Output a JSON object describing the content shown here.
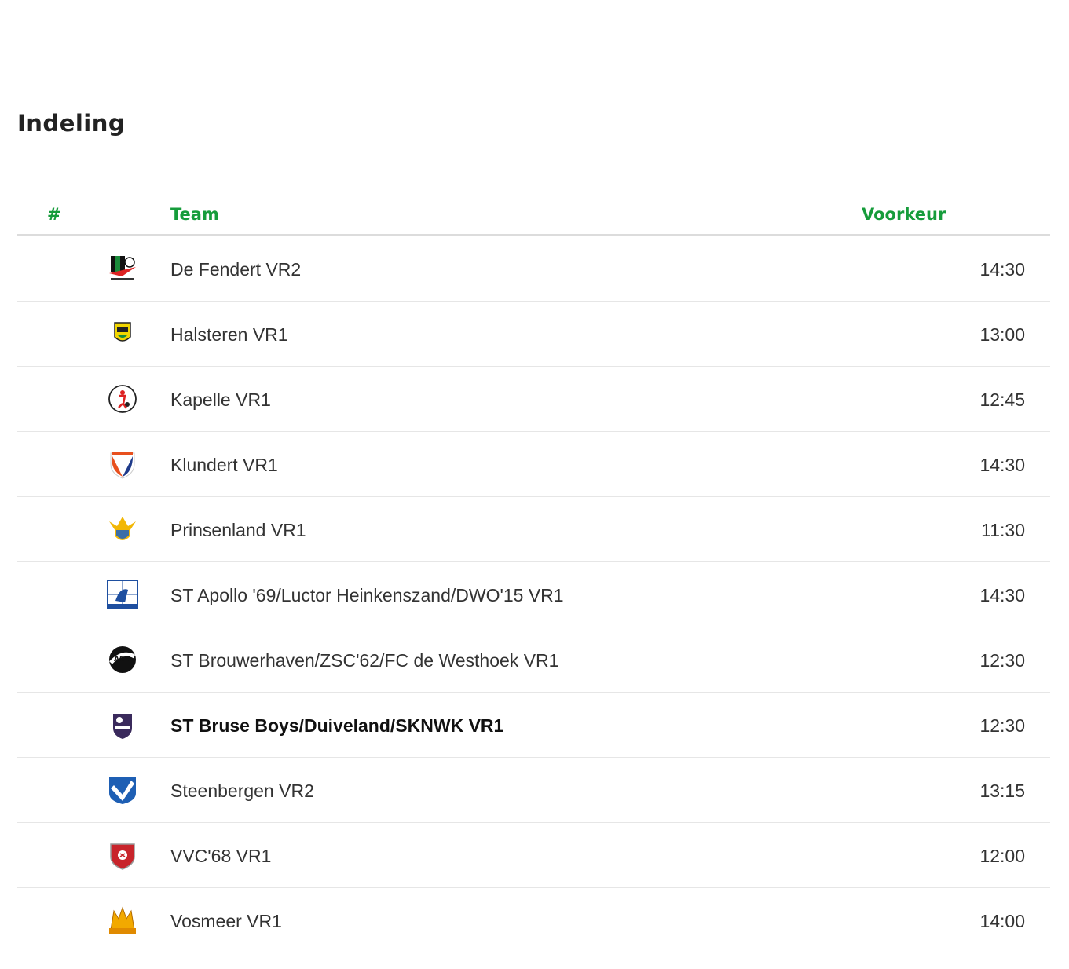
{
  "page": {
    "title": "Indeling"
  },
  "table": {
    "headers": {
      "num": "#",
      "team": "Team",
      "preference": "Voorkeur"
    },
    "rows": [
      {
        "team": "De Fendert VR2",
        "time": "14:30",
        "logo": "de-fendert-logo",
        "highlight": false
      },
      {
        "team": "Halsteren VR1",
        "time": "13:00",
        "logo": "halsteren-logo",
        "highlight": false
      },
      {
        "team": "Kapelle VR1",
        "time": "12:45",
        "logo": "kapelle-logo",
        "highlight": false
      },
      {
        "team": "Klundert VR1",
        "time": "14:30",
        "logo": "klundert-logo",
        "highlight": false
      },
      {
        "team": "Prinsenland VR1",
        "time": "11:30",
        "logo": "prinsenland-logo",
        "highlight": false
      },
      {
        "team": "ST Apollo '69/Luctor Heinkenszand/DWO'15 VR1",
        "time": "14:30",
        "logo": "apollo-logo",
        "highlight": false
      },
      {
        "team": "ST Brouwerhaven/ZSC'62/FC de Westhoek VR1",
        "time": "12:30",
        "logo": "brouwerhaven-logo",
        "highlight": false
      },
      {
        "team": "ST Bruse Boys/Duiveland/SKNWK VR1",
        "time": "12:30",
        "logo": "bruse-boys-logo",
        "highlight": true
      },
      {
        "team": "Steenbergen VR2",
        "time": "13:15",
        "logo": "steenbergen-logo",
        "highlight": false
      },
      {
        "team": "VVC'68 VR1",
        "time": "12:00",
        "logo": "vvc68-logo",
        "highlight": false
      },
      {
        "team": "Vosmeer VR1",
        "time": "14:00",
        "logo": "vosmeer-logo",
        "highlight": false
      }
    ]
  },
  "colors": {
    "header": "#169c3b",
    "divider": "#dcdcdc",
    "row_border": "#e6e6e6"
  }
}
